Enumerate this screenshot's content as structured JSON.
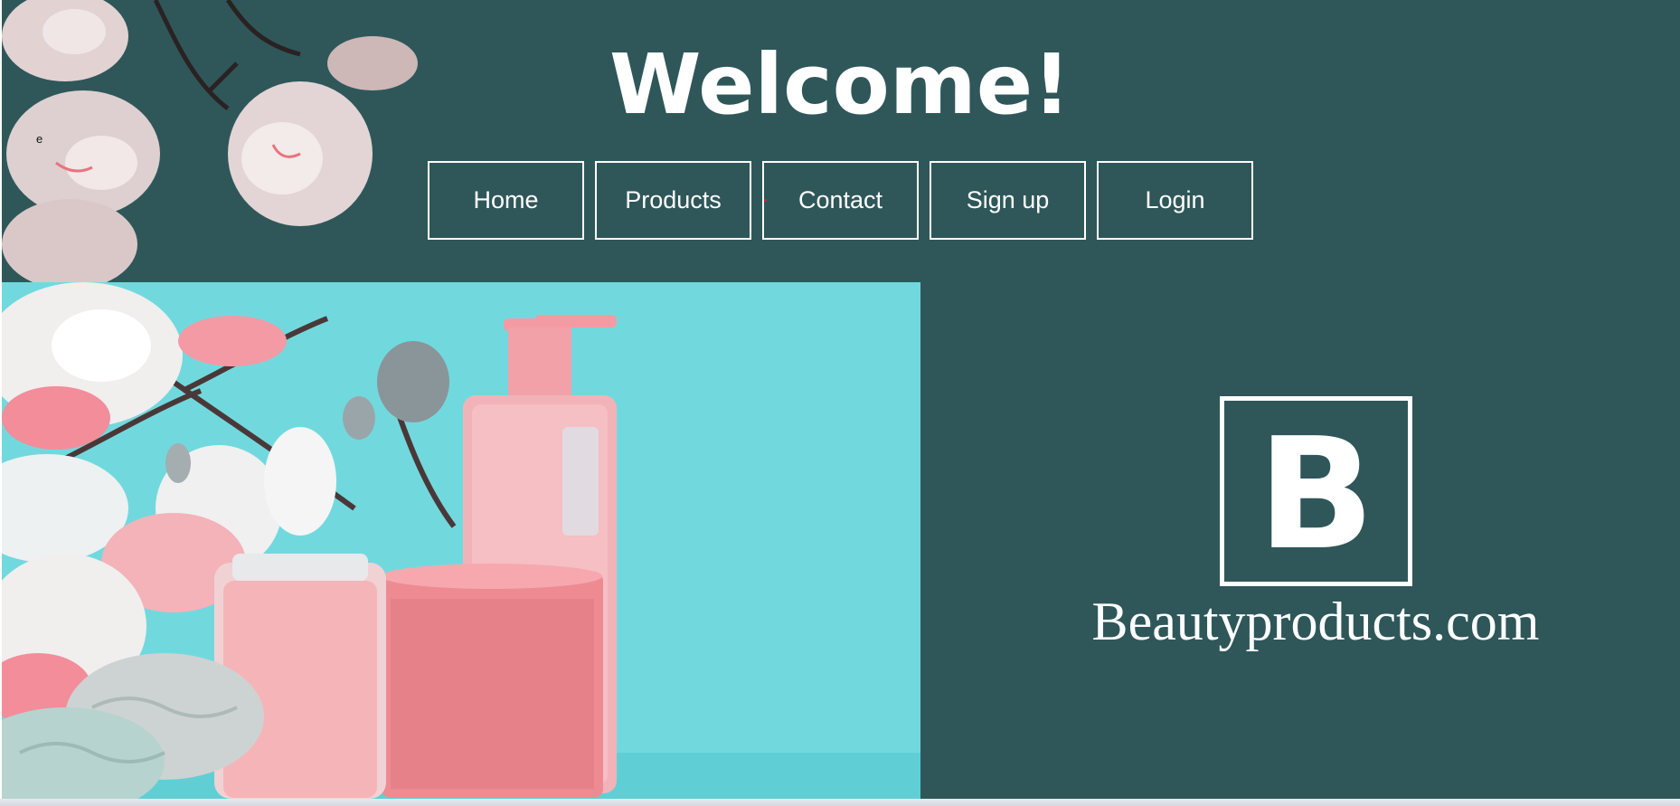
{
  "page": {
    "title": "Welcome!",
    "stray_text": "e"
  },
  "nav": {
    "items": [
      {
        "label": "Home",
        "name": "nav-home-button"
      },
      {
        "label": "Products",
        "name": "nav-products-button"
      },
      {
        "label": "Contact",
        "name": "nav-contact-button"
      },
      {
        "label": "Sign up",
        "name": "nav-signup-button"
      },
      {
        "label": "Login",
        "name": "nav-login-button"
      }
    ]
  },
  "brand": {
    "logo_letter": "B",
    "name": "Beautyproducts.com"
  },
  "colors": {
    "background": "#2f575a",
    "hero_background": "#71d9de",
    "text": "#ffffff",
    "accent_pink": "#f08a92"
  },
  "hero": {
    "image_description_icon": "cosmetics-photo"
  }
}
